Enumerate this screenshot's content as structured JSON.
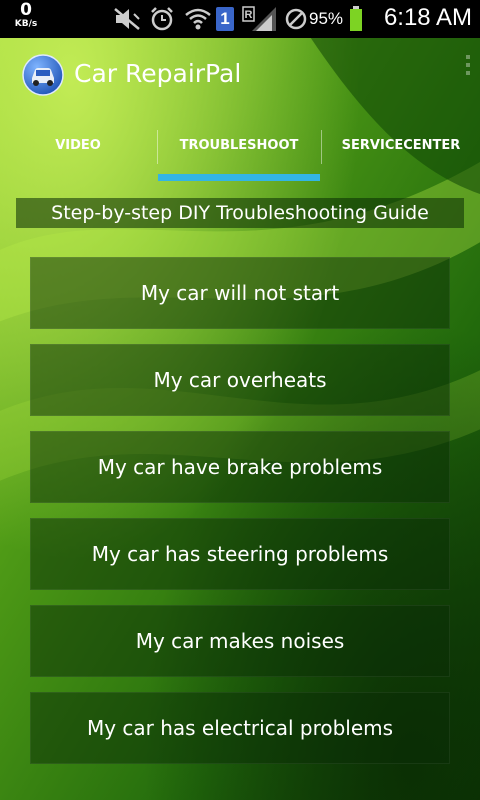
{
  "status_bar": {
    "data_speed_value": "0",
    "data_speed_unit": "KB/s",
    "sim_label": "1",
    "roaming_label": "R",
    "battery_percent": "95%",
    "clock": "6:18 AM"
  },
  "app": {
    "title": "Car RepairPal"
  },
  "tabs": [
    {
      "label": "VIDEO",
      "selected": false
    },
    {
      "label": "TROUBLESHOOT",
      "selected": true
    },
    {
      "label": "SERVICECENTER",
      "selected": false
    }
  ],
  "guide": {
    "heading": "Step-by-step DIY Troubleshooting Guide"
  },
  "issues": [
    {
      "label": "My car will not start"
    },
    {
      "label": "My car overheats"
    },
    {
      "label": "My car have brake problems"
    },
    {
      "label": "My car has steering problems"
    },
    {
      "label": "My car makes noises"
    },
    {
      "label": "My car has electrical problems"
    }
  ],
  "colors": {
    "tab_indicator": "#33b5e5",
    "sim_badge": "#3a66c9",
    "background_dark": "#0e3a06",
    "background_light": "#8fd12a"
  }
}
